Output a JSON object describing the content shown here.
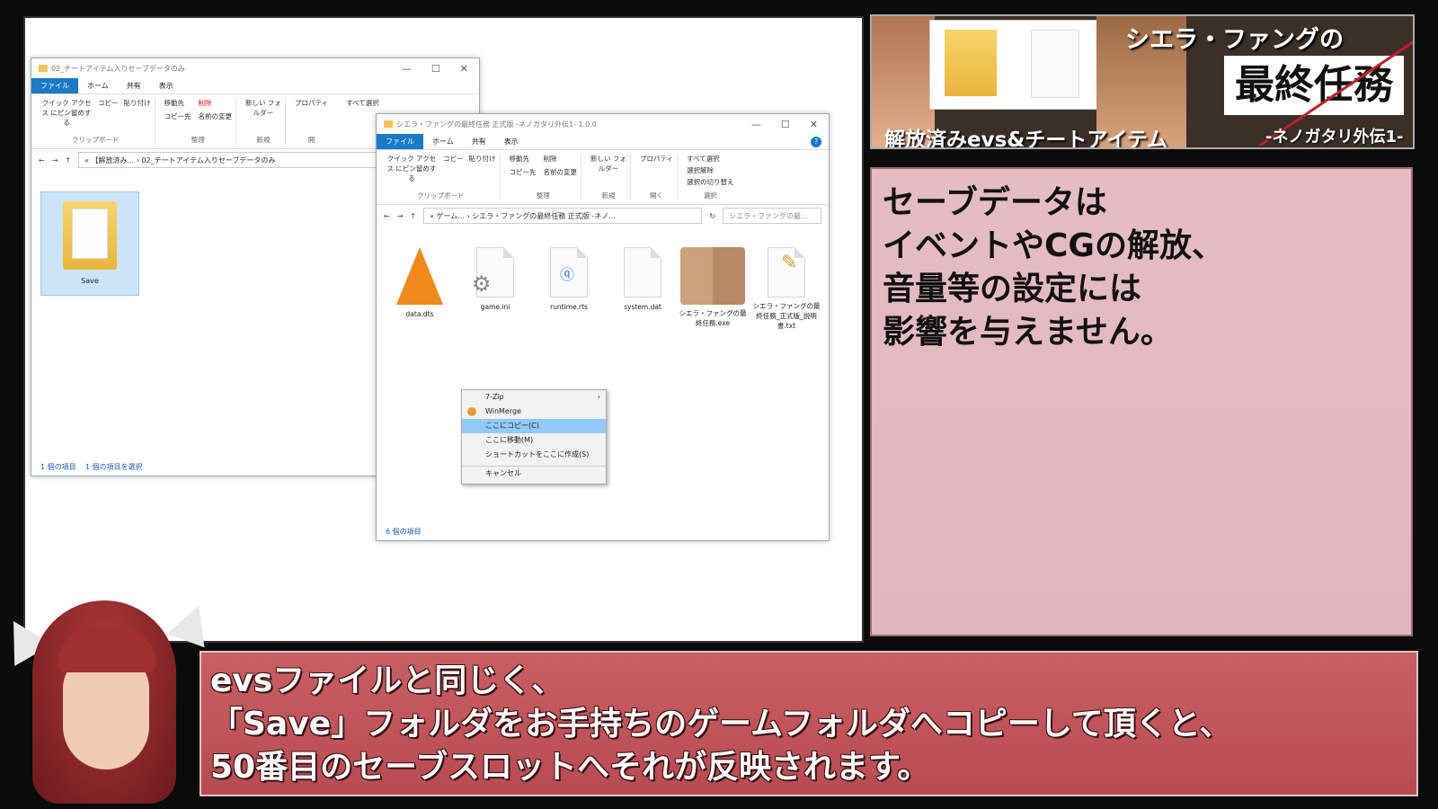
{
  "window1": {
    "title": "02_チートアイテム入りセーブデータのみ",
    "tabs": [
      "ファイル",
      "ホーム",
      "共有",
      "表示"
    ],
    "ribbon": {
      "pin": "クイック アクセス にピン留めする",
      "copy": "コピー",
      "paste": "貼り付け",
      "move_to": "移動先",
      "delete": "削除",
      "copy_to": "コピー先",
      "rename": "名前の変更",
      "new_folder": "新しい フォルダー",
      "properties": "プロパティ",
      "select_all": "すべて選択",
      "group_clipboard": "クリップボード",
      "group_organize": "整理",
      "group_new": "新規",
      "group_open": "開"
    },
    "address": "« 【解放済み... › 02_チートアイテム入りセーブデータのみ",
    "folder_label": "Save",
    "status_count": "1 個の項目",
    "status_selected": "1 個の項目を選択"
  },
  "window2": {
    "title": "シエラ・ファングの最終任務 正式版 -ネノガタリ外伝1- 1.0.0",
    "tabs": [
      "ファイル",
      "ホーム",
      "共有",
      "表示"
    ],
    "ribbon": {
      "pin": "クイック アクセス にピン留めする",
      "copy": "コピー",
      "paste": "貼り付け",
      "move_to": "移動先",
      "delete": "削除",
      "copy_to": "コピー先",
      "rename": "名前の変更",
      "new_folder": "新しい フォルダー",
      "properties": "プロパティ",
      "select_all": "すべて選択",
      "select_none": "選択解除",
      "invert": "選択の切り替え",
      "group_clipboard": "クリップボード",
      "group_organize": "整理",
      "group_new": "新規",
      "group_open": "開く",
      "group_select": "選択"
    },
    "address": "« ゲーム... › シエラ・ファングの最終任務 正式版 -ネノ...",
    "search_placeholder": "シエラ・ファングの最...",
    "files": [
      {
        "name": "data.dts",
        "icon": "vlc-cone-icon"
      },
      {
        "name": "game.ini",
        "icon": "settings-file-icon"
      },
      {
        "name": "runtime.rts",
        "icon": "rts-file-icon"
      },
      {
        "name": "system.dat",
        "icon": "blank-file-icon"
      },
      {
        "name": "シエラ・ファングの最終任務.exe",
        "icon": "game-exe-icon"
      },
      {
        "name": "シエラ・ファングの最終任務_正式版_説明書.txt",
        "icon": "text-file-icon"
      }
    ],
    "status_count": "6 個の項目"
  },
  "context_menu": {
    "items": [
      "7-Zip",
      "WinMerge",
      "ここにコピー(C)",
      "ここに移動(M)",
      "ショートカットをここに作成(S)",
      "キャンセル"
    ],
    "selected_index": 2
  },
  "banner": {
    "title_small": "シエラ・ファングの",
    "title_big": "最終任務",
    "subtitle_left": "解放済みevs&チートアイテム",
    "subtitle_right": "-ネノガタリ外伝1-"
  },
  "note": {
    "lines": [
      "セーブデータは",
      "イベントやCGの解放、",
      "音量等の設定には",
      "影響を与えません。"
    ]
  },
  "subtitle": {
    "lines": [
      "evsファイルと同じく、",
      "「Save」フォルダをお手持ちのゲームフォルダへコピーして頂くと、",
      "50番目のセーブスロットへそれが反映されます。"
    ]
  },
  "colors": {
    "subtitle_bg": "#c05258",
    "note_bg": "#e3b9c1",
    "ribbon_file_tab": "#1979ca",
    "menu_selected": "#91c9f7"
  }
}
